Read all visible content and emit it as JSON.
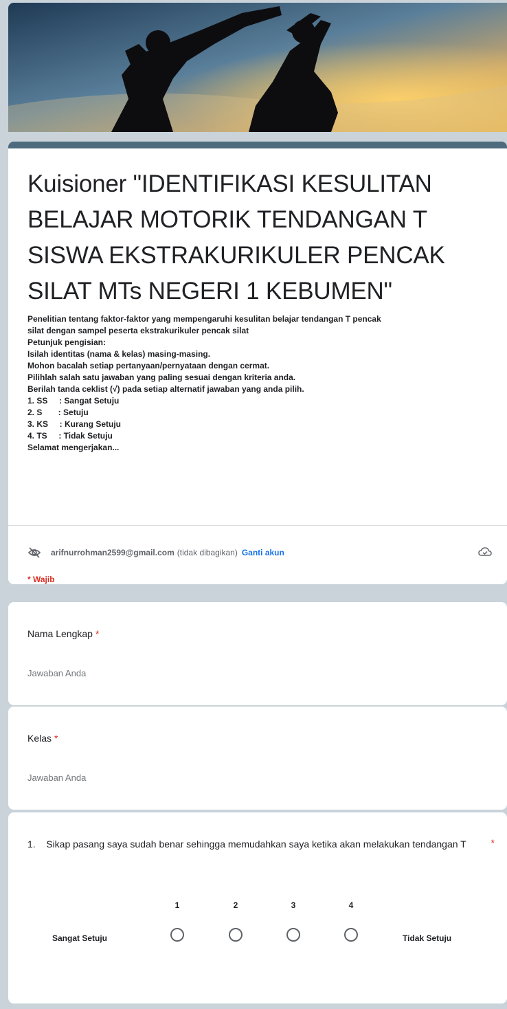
{
  "form": {
    "title": "Kuisioner \"IDENTIFIKASI KESULITAN BELAJAR MOTORIK TENDANGAN T SISWA EKSTRAKURIKULER PENCAK SILAT MTs NEGERI 1 KEBUMEN\"",
    "description_lines": [
      "Penelitian tentang faktor-faktor yang mempengaruhi kesulitan belajar tendangan T pencak",
      "silat dengan sampel peserta ekstrakurikuler pencak silat",
      "Petunjuk pengisian:",
      "Isilah identitas (nama & kelas) masing-masing.",
      "Mohon bacalah setiap pertanyaan/pernyataan dengan cermat.",
      "Pilihlah salah satu jawaban yang paling sesuai dengan kriteria anda.",
      "Berilah tanda ceklist (√) pada setiap alternatif jawaban yang anda pilih.",
      "1. SS     : Sangat Setuju",
      "2. S       : Setuju",
      "3. KS     : Kurang Setuju",
      "4. TS     : Tidak Setuju",
      "Selamat mengerjakan..."
    ]
  },
  "account": {
    "email": "arifnurrohman2599@gmail.com",
    "note": "(tidak dibagikan)",
    "switch_label": "Ganti akun",
    "required_note": "* Wajib"
  },
  "questions": [
    {
      "label": "Nama Lengkap",
      "required": "*",
      "placeholder": "Jawaban Anda"
    },
    {
      "label": "Kelas",
      "required": "*",
      "placeholder": "Jawaban Anda"
    }
  ],
  "scale_question": {
    "label": "1.    Sikap pasang saya sudah benar sehingga memudahkan saya ketika akan melakukan tendangan T",
    "required": "*",
    "options": [
      "1",
      "2",
      "3",
      "4"
    ],
    "left_label": "Sangat Setuju",
    "right_label": "Tidak Setuju"
  },
  "colors": {
    "theme_header": "#4e6b7e",
    "background": "#c9d3d9",
    "required": "#d93025",
    "link": "#1a73e8"
  }
}
